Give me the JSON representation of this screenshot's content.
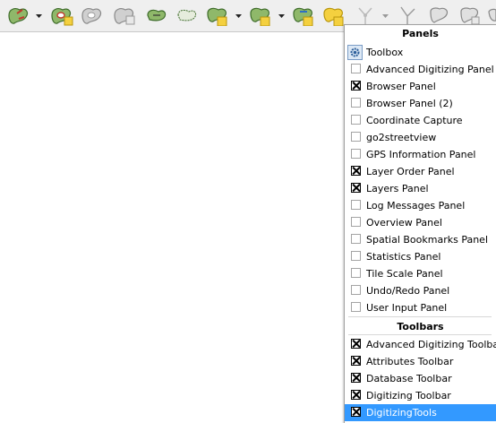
{
  "toolbar": {
    "icons": [
      {
        "name": "add-feature-icon"
      },
      {
        "name": "dropdown-arrow-icon"
      },
      {
        "name": "add-ring-icon"
      },
      {
        "name": "delete-ring-icon"
      },
      {
        "name": "delete-part-icon"
      },
      {
        "name": "reshape-icon"
      },
      {
        "name": "simplify-icon"
      },
      {
        "name": "offset-curve-icon"
      },
      {
        "name": "split-features-icon"
      },
      {
        "name": "merge-features-icon"
      },
      {
        "name": "merge-attributes-icon"
      },
      {
        "name": "node-tool-icon"
      },
      {
        "name": "vertex-icon"
      },
      {
        "name": "shape-icon"
      }
    ]
  },
  "menu": {
    "panels_header": "Panels",
    "panels": [
      {
        "label": "Toolbox",
        "checked": false,
        "icon": "gear-icon"
      },
      {
        "label": "Advanced Digitizing Panel",
        "checked": false
      },
      {
        "label": "Browser Panel",
        "checked": true
      },
      {
        "label": "Browser Panel (2)",
        "checked": false
      },
      {
        "label": "Coordinate Capture",
        "checked": false
      },
      {
        "label": "go2streetview",
        "checked": false
      },
      {
        "label": "GPS Information Panel",
        "checked": false
      },
      {
        "label": "Layer Order Panel",
        "checked": true
      },
      {
        "label": "Layers Panel",
        "checked": true
      },
      {
        "label": "Log Messages Panel",
        "checked": false
      },
      {
        "label": "Overview Panel",
        "checked": false
      },
      {
        "label": "Spatial Bookmarks Panel",
        "checked": false
      },
      {
        "label": "Statistics Panel",
        "checked": false
      },
      {
        "label": "Tile Scale Panel",
        "checked": false
      },
      {
        "label": "Undo/Redo Panel",
        "checked": false
      },
      {
        "label": "User Input Panel",
        "checked": false
      }
    ],
    "toolbars_header": "Toolbars",
    "toolbars": [
      {
        "label": "Advanced Digitizing Toolbar",
        "checked": true
      },
      {
        "label": "Attributes Toolbar",
        "checked": true
      },
      {
        "label": "Database Toolbar",
        "checked": true
      },
      {
        "label": "Digitizing Toolbar",
        "checked": true
      },
      {
        "label": "DigitizingTools",
        "checked": true,
        "highlighted": true
      }
    ],
    "highlight_color": "#3399ff"
  }
}
